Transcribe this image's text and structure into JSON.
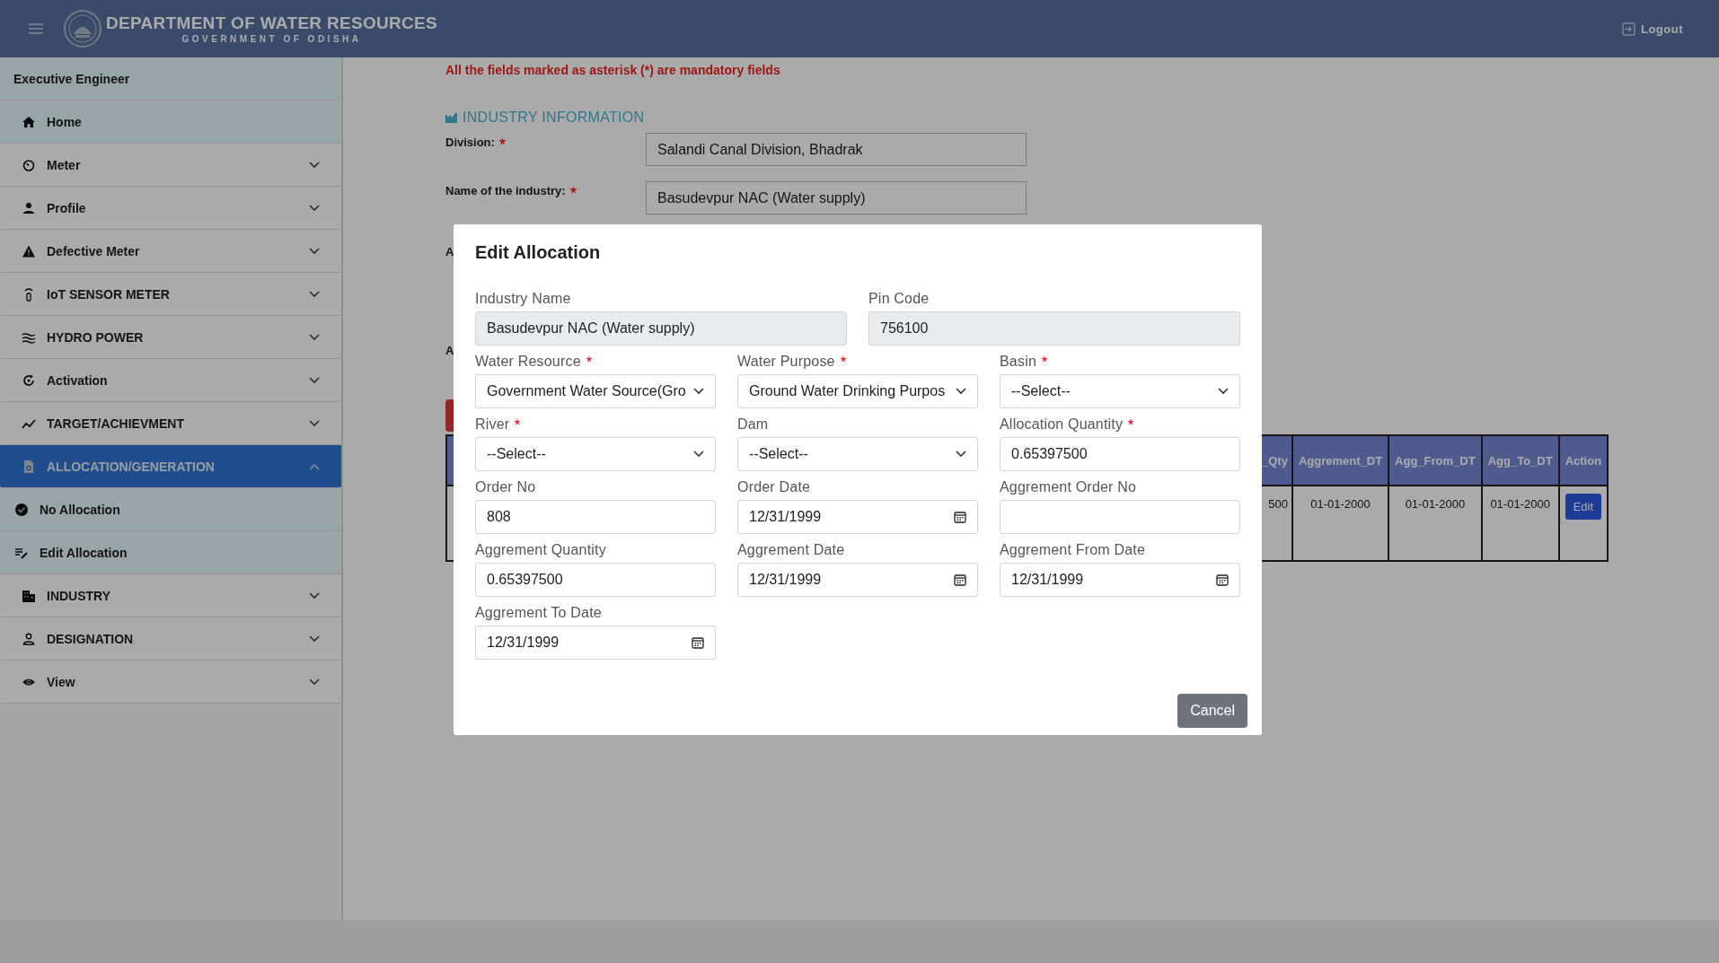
{
  "header": {
    "title": "DEPARTMENT OF WATER RESOURCES",
    "subtitle": "GOVERNMENT OF ODISHA",
    "logout": "Logout"
  },
  "sidebar": {
    "user": "Executive Engineer",
    "items": [
      {
        "label": "Home",
        "kind": "link",
        "selected": false
      },
      {
        "label": "Meter",
        "kind": "group",
        "expanded": false,
        "selected": false
      },
      {
        "label": "Profile",
        "kind": "group",
        "expanded": false,
        "selected": false
      },
      {
        "label": "Defective Meter",
        "kind": "group",
        "expanded": false,
        "selected": false
      },
      {
        "label": "IoT SENSOR METER",
        "kind": "group",
        "expanded": false,
        "selected": false
      },
      {
        "label": "HYDRO POWER",
        "kind": "group",
        "expanded": false,
        "selected": false
      },
      {
        "label": "Activation",
        "kind": "group",
        "expanded": false,
        "selected": false
      },
      {
        "label": "TARGET/ACHIEVMENT",
        "kind": "group",
        "expanded": false,
        "selected": false
      },
      {
        "label": "ALLOCATION/GENERATION",
        "kind": "group",
        "expanded": true,
        "selected": true,
        "children": [
          {
            "label": "No Allocation"
          },
          {
            "label": "Edit Allocation"
          }
        ]
      },
      {
        "label": "INDUSTRY",
        "kind": "group",
        "expanded": false,
        "selected": false
      },
      {
        "label": "DESIGNATION",
        "kind": "group",
        "expanded": false,
        "selected": false
      },
      {
        "label": "View",
        "kind": "group",
        "expanded": false,
        "selected": false
      }
    ]
  },
  "page": {
    "notice": "All the fields marked as asterisk (*) are mandatory fields",
    "section_title": "INDUSTRY INFORMATION",
    "fields": [
      {
        "label": "Division:",
        "required": true,
        "value": "Salandi Canal Division, Bhadrak"
      },
      {
        "label": "Name of the industry:",
        "required": true,
        "value": "Basudevpur NAC (Water supply)"
      },
      {
        "label": "A"
      },
      {
        "label": "A"
      }
    ],
    "table": {
      "columns": [
        "_Qty",
        "Aggrement_DT",
        "Agg_From_DT",
        "Agg_To_DT",
        "Action"
      ],
      "rows": [
        {
          "cells": [
            "500",
            "01-01-2000",
            "01-01-2000",
            "01-01-2000"
          ],
          "action": "Edit"
        }
      ]
    }
  },
  "modal": {
    "title": "Edit Allocation",
    "rows": [
      [
        {
          "label": "Industry Name",
          "kind": "readonly",
          "value": "Basudevpur NAC (Water supply)"
        },
        {
          "label": "Pin Code",
          "kind": "readonly",
          "value": "756100"
        }
      ],
      [
        {
          "label": "Water Resource",
          "kind": "select",
          "required": true,
          "value": "Government Water Source(Gro"
        },
        {
          "label": "Water Purpose",
          "kind": "select",
          "required": true,
          "value": "Ground Water Drinking Purpos"
        },
        {
          "label": "Basin",
          "kind": "select",
          "required": true,
          "value": "--Select--"
        }
      ],
      [
        {
          "label": "River",
          "kind": "select",
          "required": true,
          "value": "--Select--"
        },
        {
          "label": "Dam",
          "kind": "select",
          "value": "--Select--"
        },
        {
          "label": "Allocation Quantity",
          "kind": "text",
          "required": true,
          "value": "0.65397500"
        }
      ],
      [
        {
          "label": "Order No",
          "kind": "text",
          "value": "808"
        },
        {
          "label": "Order Date",
          "kind": "date",
          "value": "12/31/1999"
        },
        {
          "label": "Aggrement Order No",
          "kind": "text"
        }
      ],
      [
        {
          "label": "Aggrement Quantity",
          "kind": "text",
          "value": "0.65397500"
        },
        {
          "label": "Aggrement Date",
          "kind": "date",
          "value": "12/31/1999"
        },
        {
          "label": "Aggrement From Date",
          "kind": "date",
          "value": "12/31/1999"
        }
      ],
      [
        {
          "label": "Aggrement To Date",
          "kind": "date",
          "value": "12/31/1999"
        }
      ]
    ],
    "cancel": "Cancel"
  }
}
